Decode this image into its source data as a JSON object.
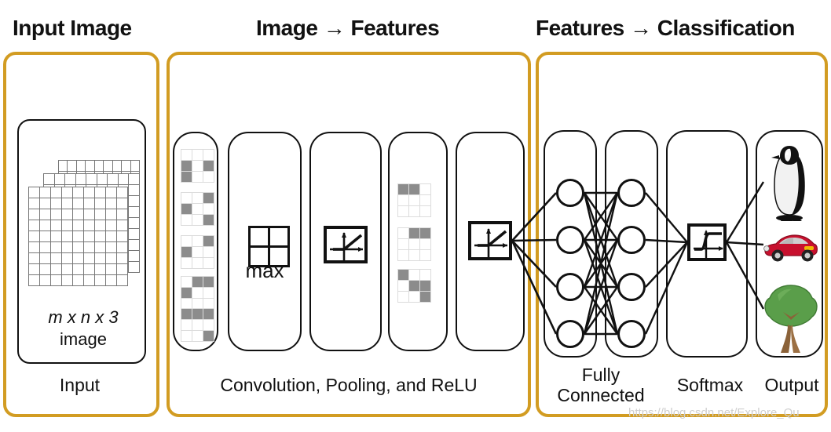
{
  "headers": [
    {
      "id": "input-image",
      "text": "Input Image"
    },
    {
      "id": "image-features",
      "text": "Image → Features"
    },
    {
      "id": "features-classification",
      "text": "Features → Classification"
    }
  ],
  "panels": {
    "input": {
      "caption": "Input",
      "border_color": "#D29C22"
    },
    "features": {
      "caption": "Convolution, Pooling, and ReLU",
      "border_color": "#D29C22"
    },
    "classification": {
      "border_color": "#D29C22",
      "captions": {
        "fully_connected": "Fully Connected",
        "softmax": "Softmax",
        "output": "Output"
      }
    }
  },
  "input_card": {
    "dims_label": "m x n x 3",
    "image_label": "image",
    "stack_count": 3,
    "grid_rows": 9,
    "grid_cols": 9
  },
  "feature_columns": [
    {
      "name": "convolution-kernels",
      "kernels": [
        {
          "name": "kernel-1",
          "cells": [
            [
              "w",
              "w",
              "w"
            ],
            [
              "g",
              "w",
              "g"
            ],
            [
              "g",
              "w",
              "w"
            ]
          ]
        },
        {
          "name": "kernel-2",
          "cells": [
            [
              "w",
              "w",
              "g"
            ],
            [
              "g",
              "w",
              "w"
            ],
            [
              "w",
              "w",
              "g"
            ]
          ]
        },
        {
          "name": "kernel-3",
          "cells": [
            [
              "w",
              "w",
              "g"
            ],
            [
              "g",
              "w",
              "w"
            ],
            [
              "w",
              "w",
              "w"
            ]
          ]
        },
        {
          "name": "kernel-4",
          "cells": [
            [
              "w",
              "g",
              "g"
            ],
            [
              "g",
              "w",
              "w"
            ],
            [
              "w",
              "w",
              "w"
            ]
          ]
        },
        {
          "name": "kernel-5",
          "cells": [
            [
              "g",
              "g",
              "g"
            ],
            [
              "w",
              "w",
              "w"
            ],
            [
              "w",
              "w",
              "g"
            ]
          ]
        }
      ]
    },
    {
      "name": "max-pooling",
      "icon": "max-pool-grid-icon",
      "label": "max"
    },
    {
      "name": "relu-1",
      "icon": "relu-curve-icon"
    },
    {
      "name": "feature-maps",
      "maps": [
        {
          "name": "feature-map-1",
          "cells": [
            [
              "g",
              "g",
              "w"
            ],
            [
              "w",
              "w",
              "w"
            ],
            [
              "w",
              "w",
              "w"
            ]
          ]
        },
        {
          "name": "feature-map-2",
          "cells": [
            [
              "w",
              "g",
              "g"
            ],
            [
              "w",
              "w",
              "w"
            ],
            [
              "w",
              "w",
              "w"
            ]
          ]
        },
        {
          "name": "feature-map-3",
          "cells": [
            [
              "g",
              "w",
              "w"
            ],
            [
              "w",
              "g",
              "g"
            ],
            [
              "w",
              "w",
              "g"
            ]
          ]
        }
      ]
    },
    {
      "name": "relu-2",
      "icon": "relu-curve-icon"
    }
  ],
  "classification": {
    "fc_layers": [
      {
        "name": "fc-layer-1",
        "node_count": 4
      },
      {
        "name": "fc-layer-2",
        "node_count": 4
      }
    ],
    "softmax": {
      "icon": "sigmoid-curve-icon"
    },
    "outputs": [
      {
        "name": "penguin",
        "label": "penguin"
      },
      {
        "name": "car",
        "label": "red sports car"
      },
      {
        "name": "tree",
        "label": "tree"
      }
    ]
  },
  "watermark": "https://blog.csdn.net/Explore_Qu",
  "colors": {
    "panel_border": "#D29C22",
    "ink": "#111111",
    "cell_gray": "#8C8C8C",
    "cell_white": "#FFFFFF",
    "grid_line": "#777777"
  }
}
